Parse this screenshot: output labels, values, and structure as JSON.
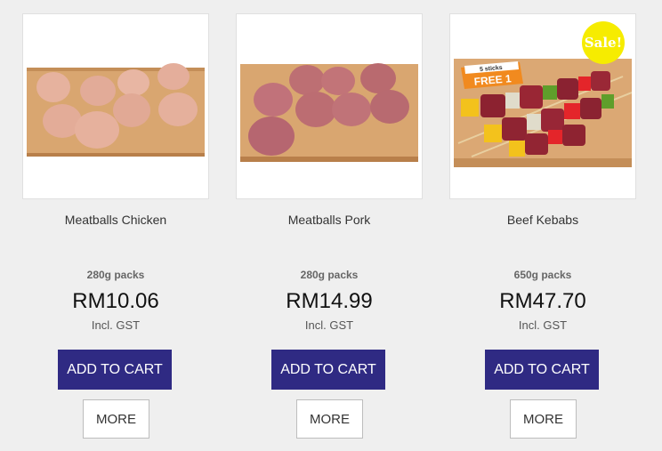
{
  "products": [
    {
      "name": "Meatballs Chicken",
      "pack": "280g packs",
      "price": "RM10.06",
      "tax_note": "Incl. GST",
      "add_to_cart": "ADD TO CART",
      "more": "MORE"
    },
    {
      "name": "Meatballs Pork",
      "pack": "280g packs",
      "price": "RM14.99",
      "tax_note": "Incl. GST",
      "add_to_cart": "ADD TO CART",
      "more": "MORE"
    },
    {
      "name": "Beef Kebabs",
      "pack": "650g packs",
      "price": "RM47.70",
      "tax_note": "Incl. GST",
      "add_to_cart": "ADD TO CART",
      "more": "MORE",
      "badge": "Sale!",
      "promo_small": "5 sticks",
      "promo_big": "FREE 1"
    }
  ],
  "colors": {
    "cart_button": "#2f2a83",
    "sale_badge": "#f6ec00",
    "background": "#efefef"
  }
}
